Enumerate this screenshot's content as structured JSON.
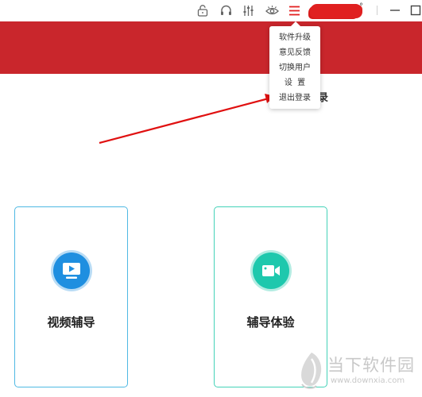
{
  "window": {
    "icons": [
      "lock-icon",
      "headset-icon",
      "equalizer-icon",
      "eye-icon",
      "menu-icon",
      "minimize-icon",
      "maximize-icon"
    ],
    "username_glyph": "°"
  },
  "menu": {
    "items": [
      {
        "label": "软件升级"
      },
      {
        "label": "意见反馈"
      },
      {
        "label": "切换用户"
      },
      {
        "label": "设  置"
      },
      {
        "label": "退出登录"
      }
    ]
  },
  "main": {
    "partial_text": "录",
    "cards": [
      {
        "label": "视频辅导",
        "icon": "video-play-icon",
        "border_color": "#4fb9e3",
        "icon_color": "#1f8fe0"
      },
      {
        "label": "辅导体验",
        "icon": "video-camera-icon",
        "border_color": "#44d2b8",
        "icon_color": "#1ec8ad"
      }
    ]
  },
  "watermark": {
    "name": "当下软件园",
    "url": "www.downxia.com"
  },
  "colors": {
    "banner": "#c9262c",
    "accent_red": "#e22020",
    "arrow": "#e01010"
  }
}
